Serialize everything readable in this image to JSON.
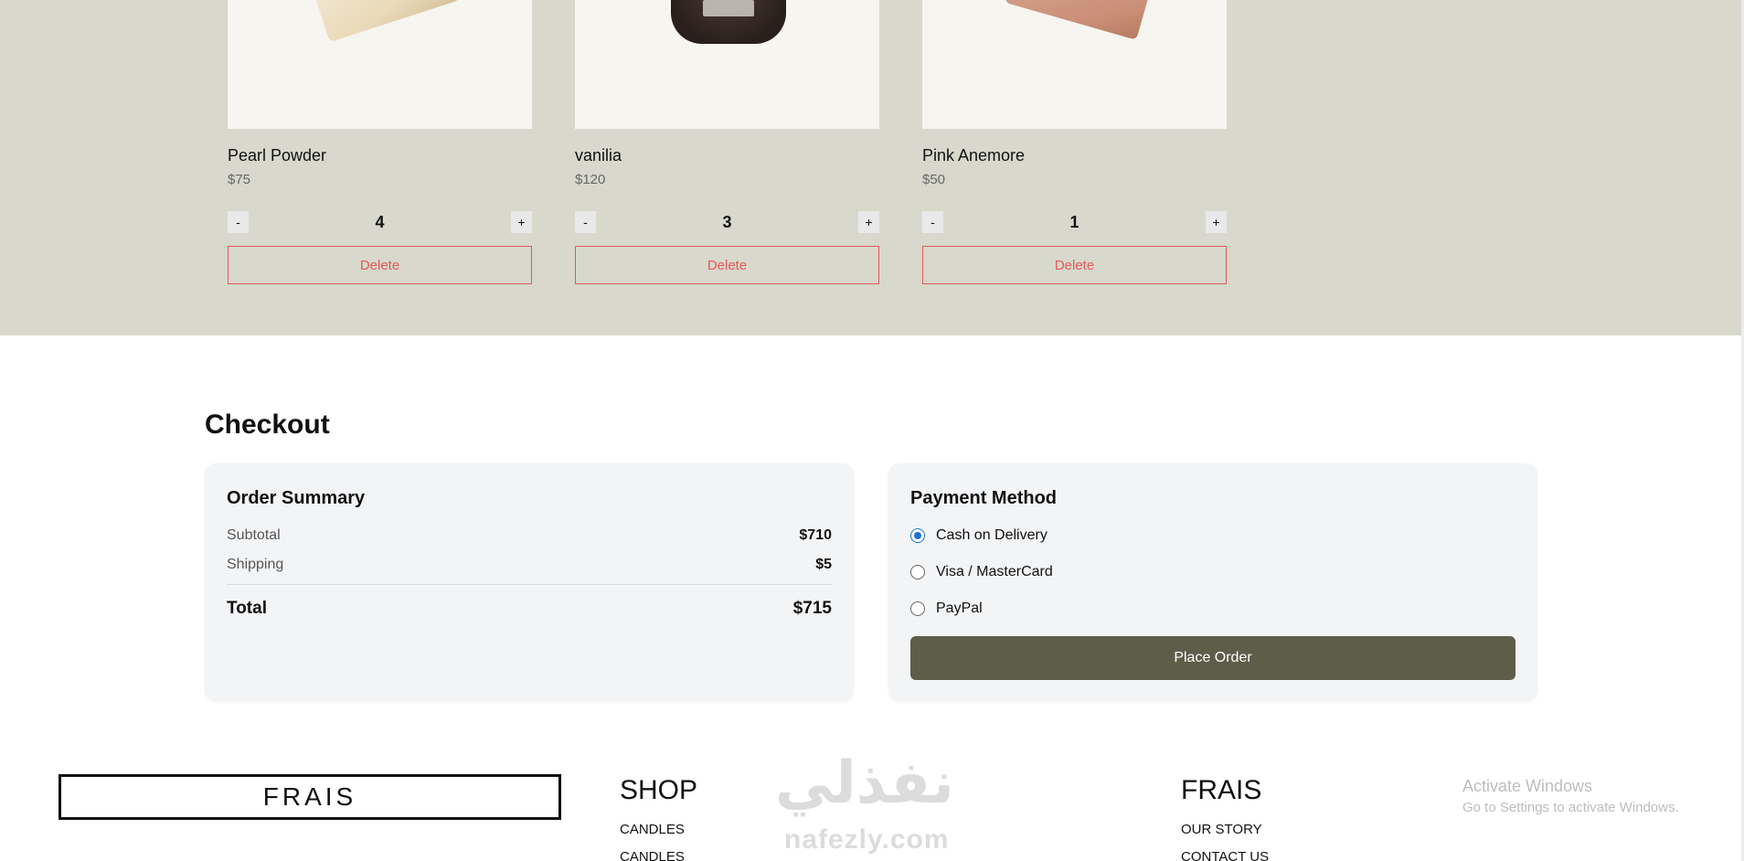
{
  "cart": {
    "items": [
      {
        "name": "Pearl Powder",
        "price": "$75",
        "quantity": "4",
        "minus_label": "-",
        "plus_label": "+",
        "delete_label": "Delete"
      },
      {
        "name": "vanilia",
        "price": "$120",
        "quantity": "3",
        "minus_label": "-",
        "plus_label": "+",
        "delete_label": "Delete"
      },
      {
        "name": "Pink Anemore",
        "price": "$50",
        "quantity": "1",
        "minus_label": "-",
        "plus_label": "+",
        "delete_label": "Delete"
      }
    ]
  },
  "checkout": {
    "title": "Checkout",
    "summary": {
      "title": "Order Summary",
      "subtotal_label": "Subtotal",
      "subtotal_value": "$710",
      "shipping_label": "Shipping",
      "shipping_value": "$5",
      "total_label": "Total",
      "total_value": "$715"
    },
    "payment": {
      "title": "Payment Method",
      "options": [
        {
          "label": "Cash on Delivery",
          "selected": true
        },
        {
          "label": "Visa / MasterCard",
          "selected": false
        },
        {
          "label": "PayPal",
          "selected": false
        }
      ],
      "place_order_label": "Place Order"
    }
  },
  "footer": {
    "logo": "FRAIS",
    "shop": {
      "heading": "SHOP",
      "links": [
        "CANDLES",
        "CANDLES"
      ]
    },
    "frais": {
      "heading": "FRAIS",
      "links": [
        "OUR STORY",
        "CONTACT US"
      ]
    }
  },
  "watermark": {
    "arabic": "نفذلي",
    "latin": "nafezly.com"
  },
  "windows_activation": {
    "title": "Activate Windows",
    "subtitle": "Go to Settings to activate Windows."
  },
  "colors": {
    "cart_bg": "#d8d8cc",
    "accent_delete": "#e05a5a",
    "place_order_bg": "#5d5d49",
    "radio_selected": "#1a73c8"
  }
}
